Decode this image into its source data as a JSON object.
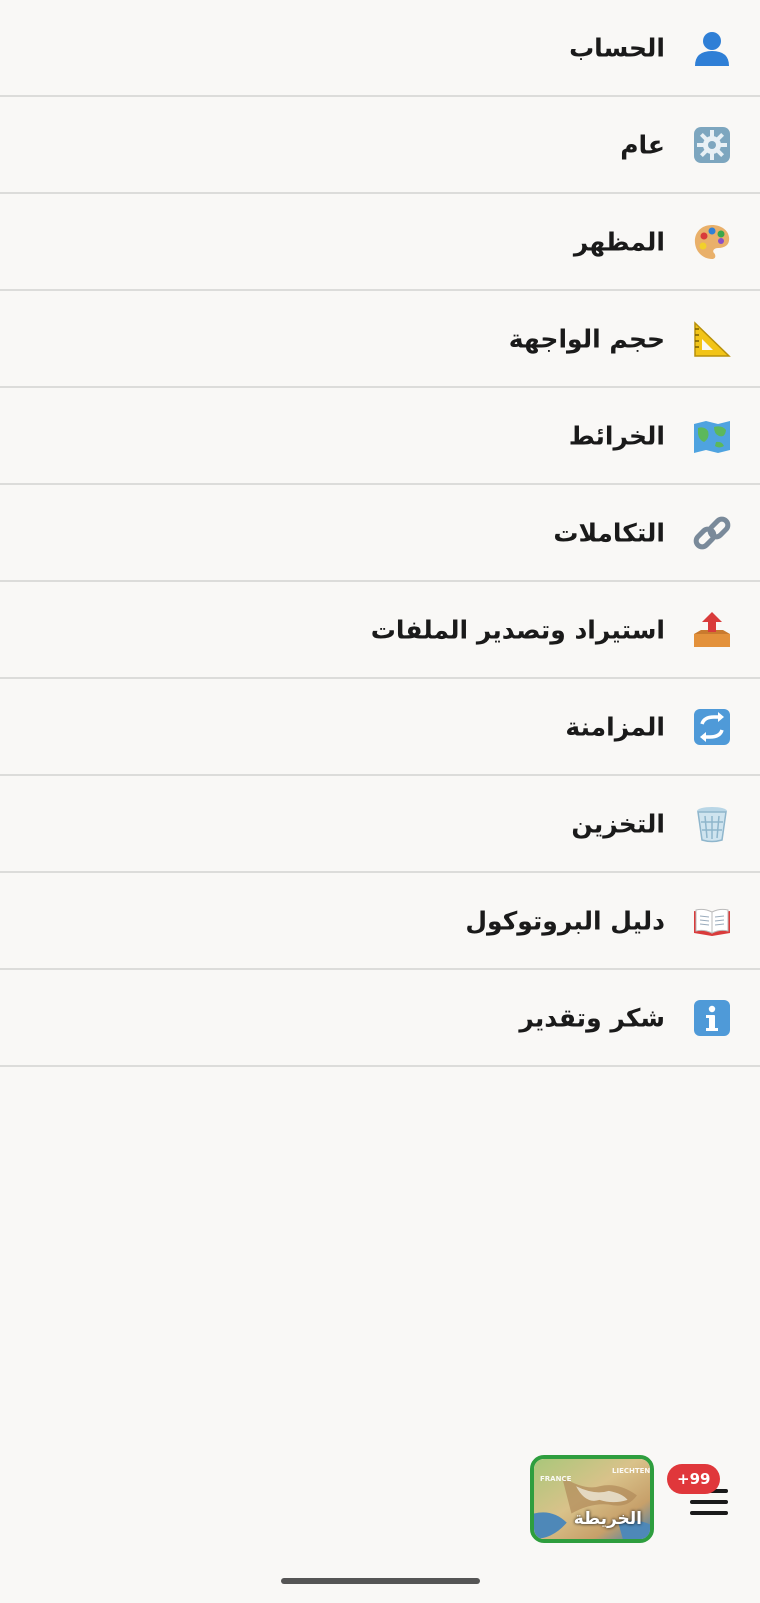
{
  "menu": {
    "items": [
      {
        "label": "الحساب",
        "icon": "user-icon"
      },
      {
        "label": "عام",
        "icon": "gear-icon"
      },
      {
        "label": "المظهر",
        "icon": "palette-icon"
      },
      {
        "label": "حجم الواجهة",
        "icon": "triangle-ruler-icon"
      },
      {
        "label": "الخرائط",
        "icon": "map-icon"
      },
      {
        "label": "التكاملات",
        "icon": "link-icon"
      },
      {
        "label": "استيراد وتصدير الملفات",
        "icon": "outbox-tray-icon"
      },
      {
        "label": "المزامنة",
        "icon": "sync-arrows-icon"
      },
      {
        "label": "التخزين",
        "icon": "trash-bin-icon"
      },
      {
        "label": "دليل البروتوكول",
        "icon": "open-book-icon"
      },
      {
        "label": "شكر وتقدير",
        "icon": "info-icon"
      }
    ]
  },
  "bottom_bar": {
    "map_button_label": "الخريطة",
    "map_regions": [
      "FRANCE",
      "LIECHTENS"
    ],
    "badge_count": "+99",
    "menu_icon": "hamburger-menu-icon"
  },
  "colors": {
    "background": "#f9f8f6",
    "divider": "#dcdcda",
    "badge": "#e0373b",
    "map_border": "#2e9e3e"
  }
}
